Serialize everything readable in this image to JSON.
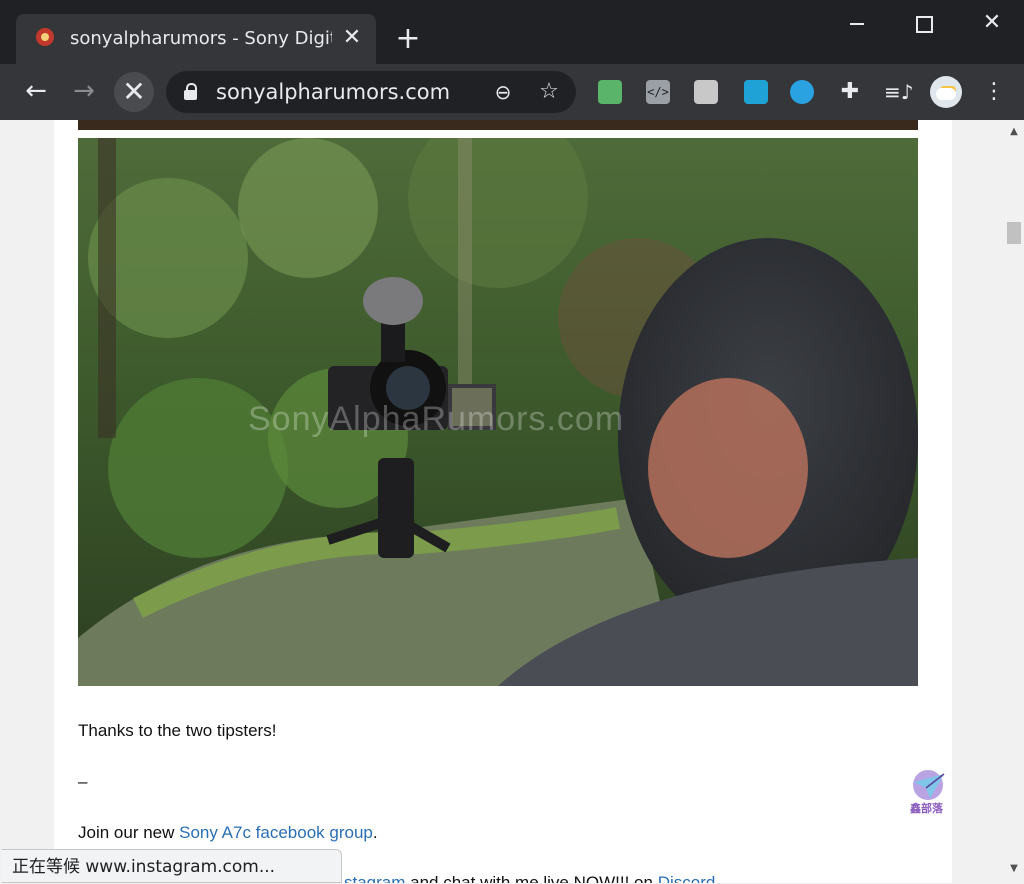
{
  "browser": {
    "tab": {
      "title": "sonyalpharumors - Sony Digita",
      "close_label": "✕",
      "favicon": "sar-favicon"
    },
    "new_tab_label": "+",
    "window_controls": {
      "minimize": "minimize-icon",
      "maximize": "maximize-icon",
      "close": "✕"
    },
    "toolbar": {
      "back": "←",
      "forward": "→",
      "stop": "✕",
      "url": "sonyalpharumors.com",
      "zoom_icon": "zoom-out-icon",
      "bookmark_icon": "star-icon",
      "extensions": [
        "mail-extension-icon",
        "code-extension-icon",
        "clipboard-extension-icon",
        "cast-extension-icon",
        "search-extension-icon",
        "puzzle-icon",
        "playlist-icon"
      ],
      "code_ext_label": "</>",
      "puzzle_glyph": "✚",
      "playlist_glyph": "≡♪",
      "menu_glyph": "⋮"
    }
  },
  "article": {
    "image_alt": "Sony camera on tripod grip filming a person in a forest",
    "watermark": "SonyAlphaRumors.com",
    "thanks_text": "Thanks to the two tipsters!",
    "separator": "–",
    "join_prefix": "Join our new ",
    "join_link": "Sony A7c facebook group",
    "join_suffix": ".",
    "partial_link_1": "stagram",
    "partial_middle": " and chat with me live NOW!!! on ",
    "partial_link_2": "Discord"
  },
  "status_bar": {
    "text": "正在等候 www.instagram.com..."
  },
  "corner_logo": {
    "text": "鑫部落"
  },
  "colors": {
    "chrome_dark": "#202124",
    "toolbar": "#35363a",
    "link": "#2a6fb4"
  }
}
